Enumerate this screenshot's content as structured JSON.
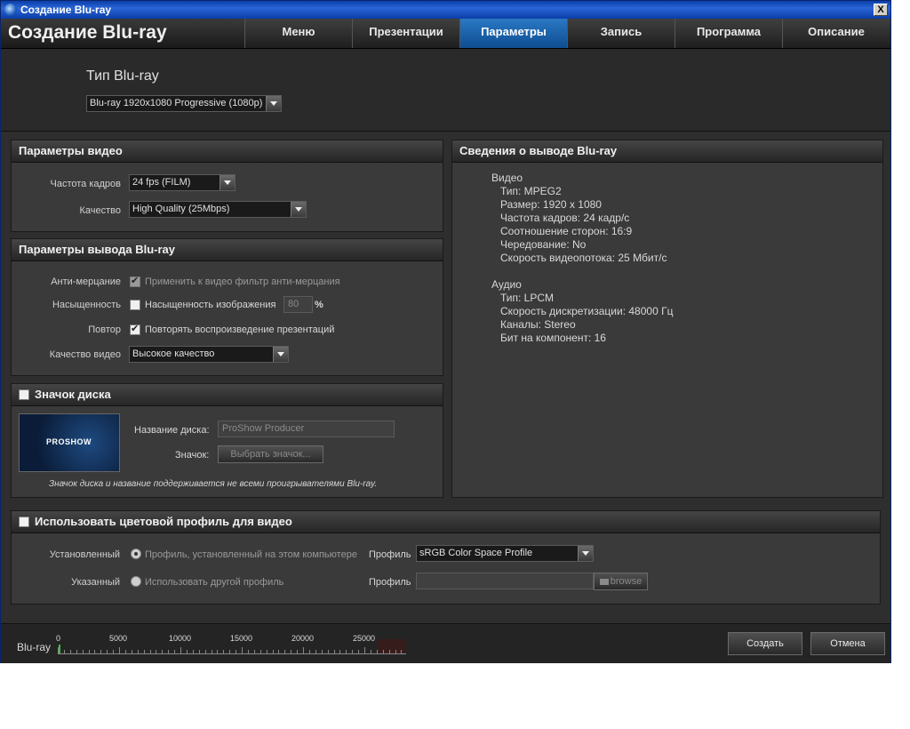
{
  "window": {
    "title": "Создание Blu-ray",
    "close_label": "X"
  },
  "header": {
    "app_title": "Создание Blu-ray",
    "tabs": [
      {
        "label": "Меню"
      },
      {
        "label": "Презентации"
      },
      {
        "label": "Параметры",
        "active": true
      },
      {
        "label": "Запись"
      },
      {
        "label": "Программа"
      },
      {
        "label": "Описание"
      }
    ]
  },
  "bluray_type": {
    "label": "Тип Blu-ray",
    "selected": "Blu-ray 1920x1080 Progressive (1080p)"
  },
  "video_params": {
    "title": "Параметры видео",
    "framerate_label": "Частота кадров",
    "framerate_value": "24 fps (FILM)",
    "quality_label": "Качество",
    "quality_value": "High Quality (25Mbps)"
  },
  "output_params": {
    "title": "Параметры вывода Blu-ray",
    "antiflicker_label": "Анти-мерцание",
    "antiflicker_text": "Применить к видео фильтр анти-мерцания",
    "saturation_label": "Насыщенность",
    "saturation_text": "Насыщенность изображения",
    "saturation_value": "80",
    "saturation_unit": "%",
    "repeat_label": "Повтор",
    "repeat_text": "Повторять воспроизведение презентаций",
    "video_quality_label": "Качество видео",
    "video_quality_value": "Высокое качество"
  },
  "disc_icon": {
    "title": "Значок диска",
    "thumb_text": "PROSHOW",
    "disc_name_label": "Название диска:",
    "disc_name_value": "ProShow Producer",
    "icon_label": "Значок:",
    "choose_icon_button": "Выбрать значок...",
    "note": "Значок диска и название поддерживается не всеми проигрывателями Blu-ray."
  },
  "output_info": {
    "title": "Сведения о выводе Blu-ray",
    "video_header": "Видео",
    "video_lines": [
      "Тип: MPEG2",
      "Размер: 1920 x 1080",
      "Частота кадров: 24 кадр/с",
      "Соотношение сторон: 16:9",
      "Чередование: No",
      "Скорость видеопотока: 25 Мбит/с"
    ],
    "audio_header": "Аудио",
    "audio_lines": [
      "Тип: LPCM",
      "Скорость дискретизации: 48000 Гц",
      "Каналы: Stereo",
      "Бит на компонент: 16"
    ]
  },
  "color_profile": {
    "title": "Использовать цветовой профиль для видео",
    "installed_label": "Установленный",
    "installed_text": "Профиль, установленный на этом компьютере",
    "profile_label": "Профиль",
    "profile_value": "sRGB Color Space Profile",
    "specified_label": "Указанный",
    "specified_text": "Использовать другой профиль",
    "profile_label2": "Профиль",
    "browse_label": "browse"
  },
  "footer": {
    "ruler_label": "Blu-ray",
    "ticks": [
      "0",
      "5000",
      "10000",
      "15000",
      "20000",
      "25000"
    ],
    "create_button": "Создать",
    "cancel_button": "Отмена"
  }
}
